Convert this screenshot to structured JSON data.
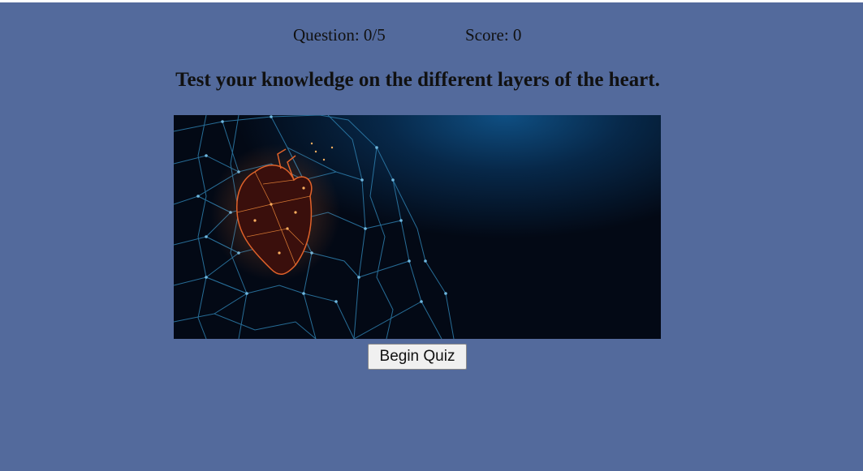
{
  "status": {
    "question_label": "Question: 0/5",
    "score_label": "Score: 0"
  },
  "heading": "Test your knowledge on the different layers of the heart.",
  "hero_image": {
    "subject": "low-poly wireframe human torso with glowing heart",
    "icon": "heart-anatomy-illustration"
  },
  "begin_button_label": "Begin Quiz",
  "colors": {
    "page_background": "#536a9c",
    "text": "#111111",
    "image_dark": "#030915",
    "wireframe": "#2e7fae",
    "heart": "#e0622a",
    "button_face": "#f0f0f0"
  }
}
